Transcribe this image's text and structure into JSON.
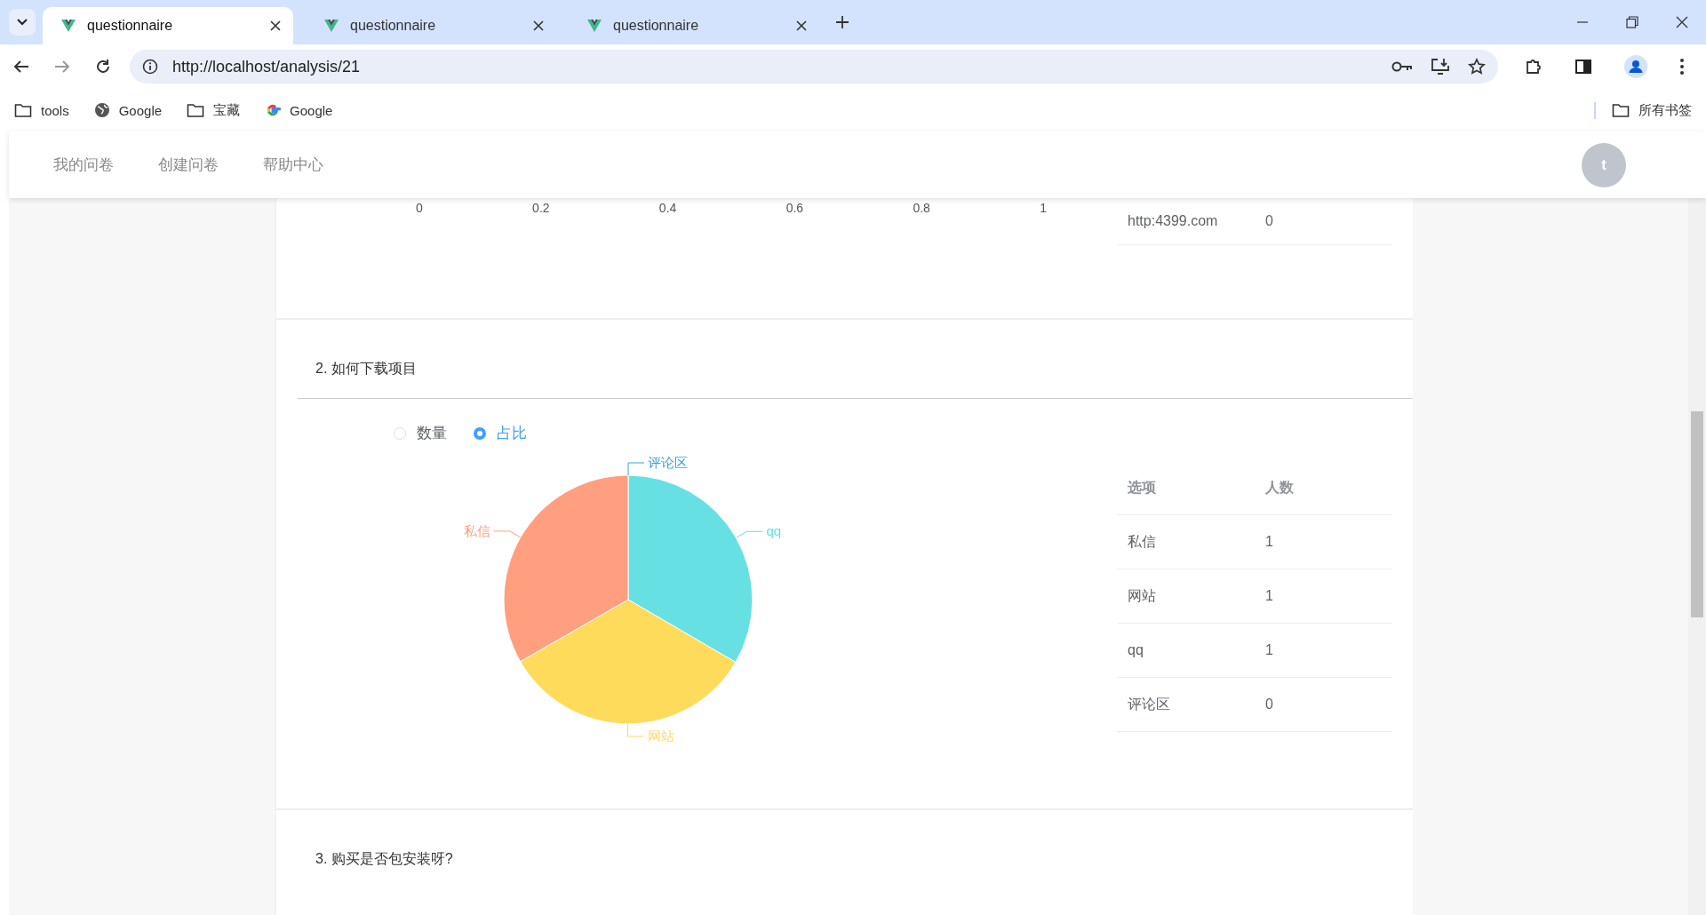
{
  "browser": {
    "tabs": [
      {
        "title": "questionnaire",
        "selected": true
      },
      {
        "title": "questionnaire",
        "selected": false
      },
      {
        "title": "questionnaire",
        "selected": false
      }
    ],
    "address": "http://localhost/analysis/21",
    "bookmarks": [
      {
        "kind": "folder",
        "label": "tools"
      },
      {
        "kind": "globe",
        "label": "Google"
      },
      {
        "kind": "folder",
        "label": "宝藏"
      },
      {
        "kind": "google",
        "label": "Google"
      }
    ],
    "all_bookmarks": "所有书签"
  },
  "header": {
    "nav": [
      {
        "label": "我的问卷"
      },
      {
        "label": "创建问卷"
      },
      {
        "label": "帮助中心"
      }
    ],
    "avatar": "t"
  },
  "sections": [
    {
      "kind": "partial",
      "axis_ticks": [
        "0",
        "0.2",
        "0.4",
        "0.6",
        "0.8",
        "1"
      ],
      "rows": [
        {
          "option": "http:4399.com",
          "count": "0"
        }
      ]
    },
    {
      "kind": "question",
      "title": "2. 如何下载项目",
      "modes": [
        {
          "label": "数量",
          "selected": false
        },
        {
          "label": "占比",
          "selected": true
        }
      ],
      "chart_data": {
        "type": "pie",
        "categories": [
          "私信",
          "网站",
          "qq",
          "评论区"
        ],
        "values": [
          33.3,
          33.3,
          33.4,
          0
        ],
        "colors": [
          "#ff9f7f",
          "#ffdb5c",
          "#67e0e3",
          "#37a2da"
        ]
      },
      "columns": [
        "选项",
        "人数"
      ],
      "rows": [
        {
          "option": "私信",
          "count": "1"
        },
        {
          "option": "网站",
          "count": "1"
        },
        {
          "option": "qq",
          "count": "1"
        },
        {
          "option": "评论区",
          "count": "0"
        }
      ]
    },
    {
      "kind": "question_title",
      "title": "3. 购买是否包安装呀?"
    }
  ]
}
